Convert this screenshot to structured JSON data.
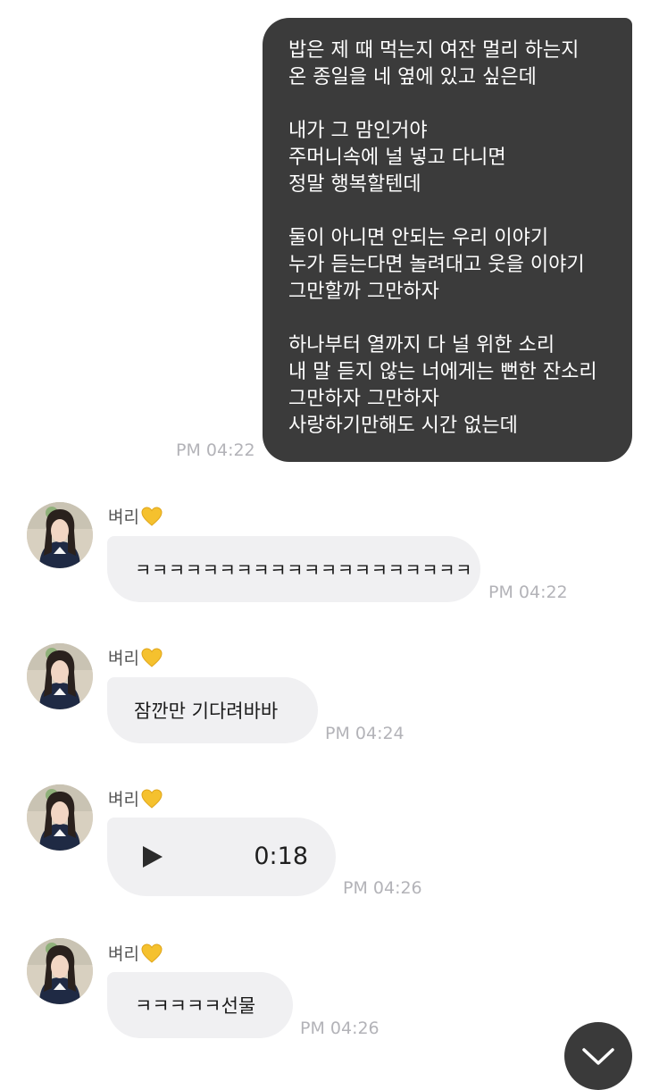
{
  "sent_message": {
    "paragraphs": [
      [
        "밥은 제 때 먹는지 여잔 멀리 하는지",
        "온 종일을 네 옆에 있고 싶은데"
      ],
      [
        "내가 그 맘인거야",
        "주머니속에 널 넣고 다니면",
        "정말 행복할텐데"
      ],
      [
        "둘이 아니면 안되는 우리 이야기",
        "누가 듣는다면 놀려대고 웃을 이야기",
        "그만할까 그만하자"
      ],
      [
        "하나부터 열까지 다 널 위한 소리",
        "내 말 듣지 않는 너에게는 뻔한 잔소리",
        "그만하자 그만하자",
        "사랑하기만해도 시간 없는데"
      ]
    ],
    "time": "PM 04:22"
  },
  "received_messages": [
    {
      "sender": "벼리",
      "text": "ㅋㅋㅋㅋㅋㅋㅋㅋㅋㅋㅋㅋㅋㅋㅋㅋㅋㅋㅋㅋ",
      "time": "PM 04:22"
    },
    {
      "sender": "벼리",
      "text": "잠깐만 기다려바바",
      "time": "PM 04:24"
    },
    {
      "sender": "벼리",
      "voice_duration": "0:18",
      "time": "PM 04:26"
    },
    {
      "sender": "벼리",
      "text": "ㅋㅋㅋㅋㅋ선물",
      "time": "PM 04:26"
    }
  ],
  "colors": {
    "sent_bubble": "#3b3b3b",
    "received_bubble": "#f0f0f2",
    "timestamp": "#b3b3b8",
    "heart": "#f5c12e"
  },
  "icons": {
    "heart": "yellow-heart-icon",
    "play": "play-icon",
    "scroll": "chevron-down-icon"
  }
}
